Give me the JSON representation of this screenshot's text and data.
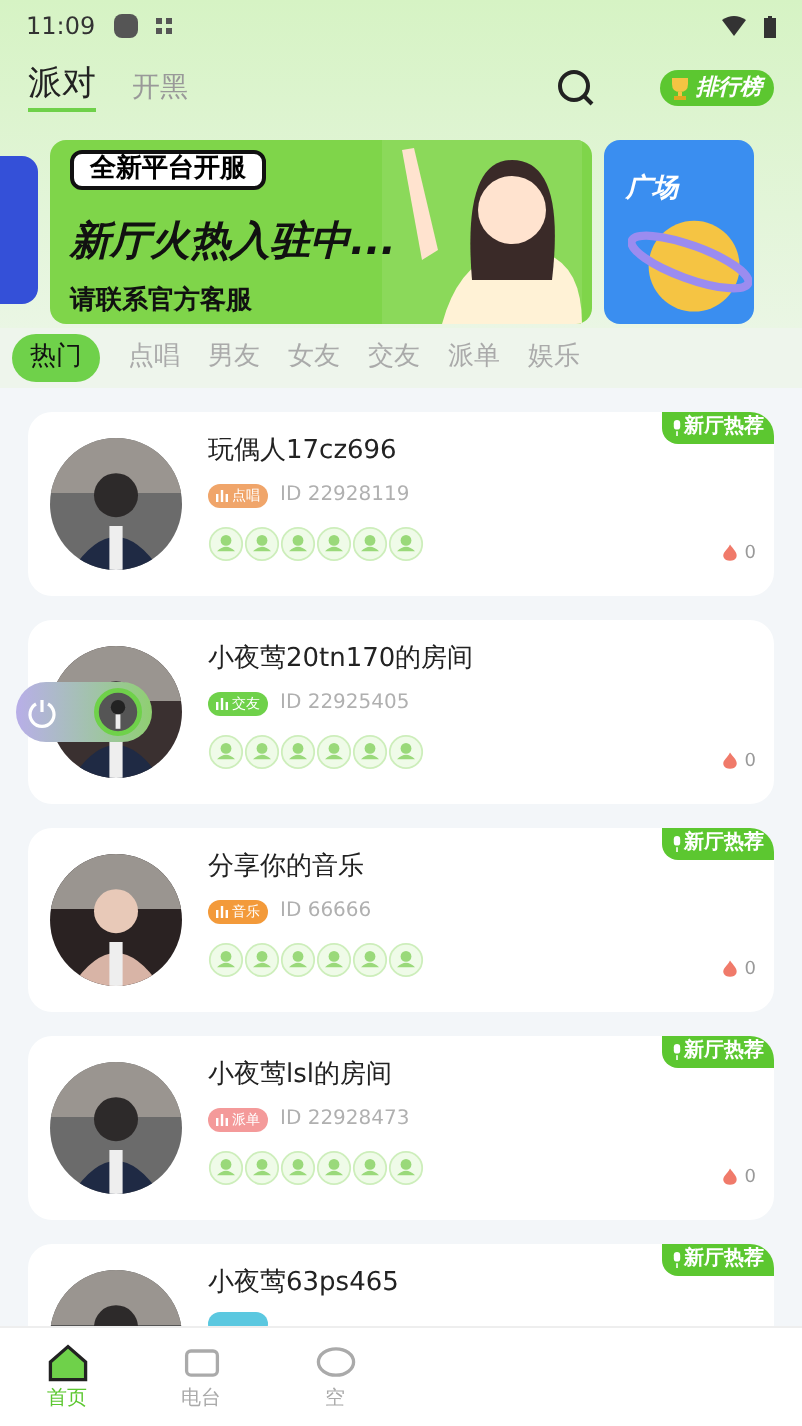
{
  "status_bar": {
    "time": "11:09"
  },
  "header": {
    "tabs": [
      {
        "label": "派对",
        "selected": true
      },
      {
        "label": "开黑",
        "selected": false
      }
    ],
    "ranking_button": "排行榜"
  },
  "banner": {
    "badge": "全新平台开服",
    "headline": "新厅火热入驻中...",
    "subline": "请联系官方客服",
    "side_card": "广场"
  },
  "categories": [
    {
      "label": "热门",
      "selected": true
    },
    {
      "label": "点唱",
      "selected": false
    },
    {
      "label": "男友",
      "selected": false
    },
    {
      "label": "女友",
      "selected": false
    },
    {
      "label": "交友",
      "selected": false
    },
    {
      "label": "派单",
      "selected": false
    },
    {
      "label": "娱乐",
      "selected": false
    }
  ],
  "rooms": [
    {
      "title": "玩偶人17cz696",
      "tag": "点唱",
      "color": "#f0a56a",
      "id": "ID 22928119",
      "heat": "0",
      "recommend": "新厅热荐"
    },
    {
      "title": "小夜莺20tn170的房间",
      "tag": "交友",
      "color": "#6fd14a",
      "id": "ID 22925405",
      "heat": "0"
    },
    {
      "title": "分享你的音乐",
      "tag": "音乐",
      "color": "#f39a3a",
      "id": "ID 66666",
      "heat": "0",
      "recommend": "新厅热荐"
    },
    {
      "title": "小夜莺lsl的房间",
      "tag": "派单",
      "color": "#f49a9a",
      "id": "ID 22928473",
      "heat": "0",
      "recommend": "新厅热荐"
    },
    {
      "title": "小夜莺63ps465",
      "color": "#5bc8e0",
      "recommend": "新厅热荐"
    }
  ],
  "bottom_nav": [
    {
      "label": "首页",
      "selected": true
    },
    {
      "label": "电台",
      "selected": false
    },
    {
      "label": "空",
      "selected": false
    }
  ]
}
